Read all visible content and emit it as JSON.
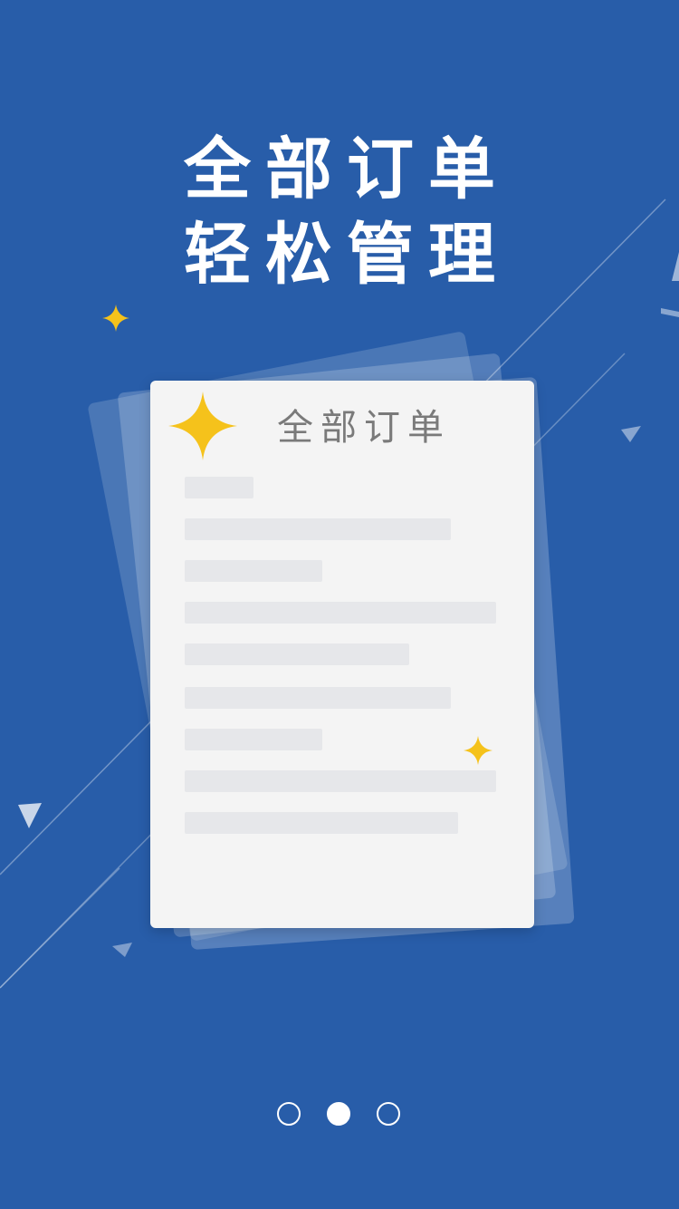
{
  "theme": {
    "background": "#285da9",
    "accent_star": "#f5c21b",
    "card_background": "#f4f4f4",
    "placeholder_bar": "#e6e7ea",
    "headline_color": "#ffffff"
  },
  "headline": {
    "line1": "全部订单",
    "line2": "轻松管理"
  },
  "card": {
    "title": "全部订单",
    "star_icon": "sparkle-star-icon",
    "placeholder_rows": 9
  },
  "pager": {
    "total": 3,
    "active_index": 1
  }
}
